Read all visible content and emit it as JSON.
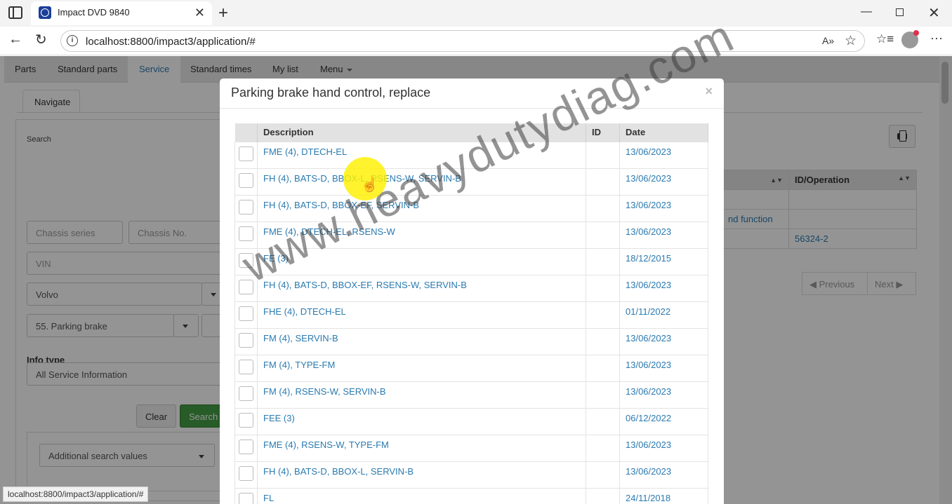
{
  "browser": {
    "tab_title": "Impact DVD 9840",
    "url": "localhost:8800/impact3/application/#",
    "status_url": "localhost:8800/impact3/application/#"
  },
  "app_nav": {
    "items": [
      "Parts",
      "Standard parts",
      "Service",
      "Standard times",
      "My list",
      "Menu"
    ],
    "active": "Service"
  },
  "subtab": "Navigate",
  "search": {
    "label": "Search",
    "chassis_series_placeholder": "Chassis series",
    "chassis_no_placeholder": "Chassis No.",
    "vin_placeholder": "VIN",
    "brand": "Volvo",
    "function_group": "55. Parking brake",
    "info_type_label": "Info type",
    "info_type_value": "All Service Information",
    "clear_label": "Clear",
    "search_label": "Search",
    "additional_label": "Additional search values"
  },
  "results": {
    "col_id_operation": "ID/Operation",
    "row2_text": "nd function",
    "row3_id": "56324-2",
    "previous_label": "Previous",
    "next_label": "Next"
  },
  "modal": {
    "title": "Parking brake hand control, replace",
    "close": "×",
    "columns": [
      "Description",
      "ID",
      "Date"
    ],
    "rows": [
      {
        "description": "FME (4), DTECH-EL",
        "id": "",
        "date": "13/06/2023"
      },
      {
        "description": "FH (4), BATS-D, BBOX-L, RSENS-W, SERVIN-B",
        "id": "",
        "date": "13/06/2023"
      },
      {
        "description": "FH (4), BATS-D, BBOX-EF, SERVIN-B",
        "id": "",
        "date": "13/06/2023"
      },
      {
        "description": "FME (4), DTECH-EL, RSENS-W",
        "id": "",
        "date": "13/06/2023"
      },
      {
        "description": "FE (3)",
        "id": "",
        "date": "18/12/2015"
      },
      {
        "description": "FH (4), BATS-D, BBOX-EF, RSENS-W, SERVIN-B",
        "id": "",
        "date": "13/06/2023"
      },
      {
        "description": "FHE (4), DTECH-EL",
        "id": "",
        "date": "01/11/2022"
      },
      {
        "description": "FM (4), SERVIN-B",
        "id": "",
        "date": "13/06/2023"
      },
      {
        "description": "FM (4), TYPE-FM",
        "id": "",
        "date": "13/06/2023"
      },
      {
        "description": "FM (4), RSENS-W, SERVIN-B",
        "id": "",
        "date": "13/06/2023"
      },
      {
        "description": "FEE (3)",
        "id": "",
        "date": "06/12/2022"
      },
      {
        "description": "FME (4), RSENS-W, TYPE-FM",
        "id": "",
        "date": "13/06/2023"
      },
      {
        "description": "FH (4), BATS-D, BBOX-L, SERVIN-B",
        "id": "",
        "date": "13/06/2023"
      },
      {
        "description": "FL",
        "id": "",
        "date": "24/11/2018"
      }
    ]
  },
  "watermark": "www.heavydutydiag.com",
  "colors": {
    "link": "#2a7ab0",
    "search_button": "#449d44",
    "cursor_highlight": "#fff000"
  },
  "icons": [
    "sidebar-toggle-icon",
    "favicon-icon",
    "close-icon",
    "plus-icon",
    "minimize-icon",
    "restore-icon",
    "back-icon",
    "reload-icon",
    "info-icon",
    "read-aloud-icon",
    "star-icon",
    "favorites-icon",
    "profile-icon",
    "more-icon",
    "print-icon",
    "sort-icon",
    "chevron-down-icon",
    "hand-cursor-icon"
  ]
}
